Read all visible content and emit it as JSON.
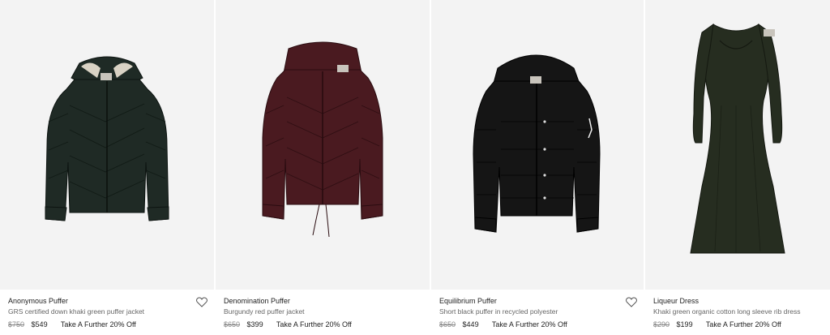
{
  "products": [
    {
      "name": "Anonymous Puffer",
      "description": "GRS certified down khaki green puffer jacket",
      "old_price": "$750",
      "price": "$549",
      "promo": "Take A Further 20% Off",
      "image_icon": "puffer-jacket-khaki-green",
      "color": "#1f2a25"
    },
    {
      "name": "Denomination Puffer",
      "description": "Burgundy red puffer jacket",
      "old_price": "$650",
      "price": "$399",
      "promo": "Take A Further 20% Off",
      "image_icon": "puffer-jacket-burgundy",
      "color": "#4a1a20"
    },
    {
      "name": "Equilibrium Puffer",
      "description": "Short black puffer in recycled polyester",
      "old_price": "$650",
      "price": "$449",
      "promo": "Take A Further 20% Off",
      "image_icon": "puffer-jacket-black",
      "color": "#151515"
    },
    {
      "name": "Liqueur Dress",
      "description": "Khaki green organic cotton long sleeve rib dress",
      "old_price": "$290",
      "price": "$199",
      "promo": "Take A Further 20% Off",
      "image_icon": "long-sleeve-dress-khaki",
      "color": "#262d20"
    }
  ],
  "wishlist_icon": "heart-icon"
}
